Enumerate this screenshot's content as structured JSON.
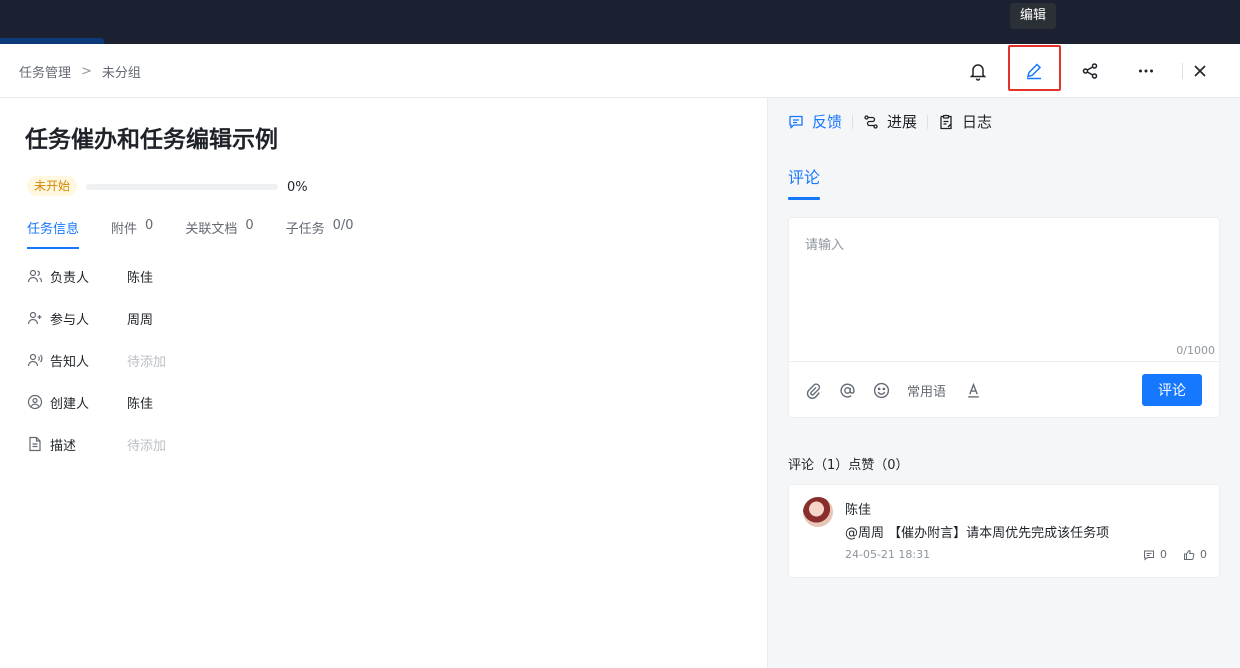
{
  "tooltip": "编辑",
  "breadcrumb": {
    "parent": "任务管理",
    "separator": ">",
    "current": "未分组"
  },
  "header_icons": {
    "notify": "bell-icon",
    "edit": "pencil-icon",
    "share": "share-icon",
    "more": "more-icon",
    "close": "close-icon"
  },
  "task": {
    "title": "任务催办和任务编辑示例",
    "status": "未开始",
    "progress_percent": 0,
    "progress_text": "0%"
  },
  "tabs": [
    {
      "label": "任务信息",
      "count": ""
    },
    {
      "label": "附件",
      "count": "0"
    },
    {
      "label": "关联文档",
      "count": "0"
    },
    {
      "label": "子任务",
      "count": "0/0"
    }
  ],
  "fields": [
    {
      "label": "负责人",
      "value": "陈佳",
      "icon": "owner-icon"
    },
    {
      "label": "参与人",
      "value": "周周",
      "icon": "add-user-icon"
    },
    {
      "label": "告知人",
      "value": "待添加",
      "icon": "notify-user-icon"
    },
    {
      "label": "创建人",
      "value": "陈佳",
      "icon": "user-circle-icon"
    },
    {
      "label": "描述",
      "value": "待添加",
      "icon": "document-icon"
    }
  ],
  "right_tabs": [
    {
      "label": "反馈",
      "icon": "feedback-icon"
    },
    {
      "label": "进展",
      "icon": "progress-icon"
    },
    {
      "label": "日志",
      "icon": "log-icon"
    }
  ],
  "comment_section": {
    "subtab": "评论",
    "placeholder": "请输入",
    "char_count": "0/1000",
    "phrases_label": "常用语",
    "submit_label": "评论",
    "summary": "评论（1）点赞（0）"
  },
  "comments": [
    {
      "author": "陈佳",
      "text": "@周周 【催办附言】请本周优先完成该任务项",
      "time": "24-05-21 18:31",
      "replies": "0",
      "likes": "0"
    }
  ],
  "colors": {
    "accent": "#1677ff",
    "highlight_box": "#e5332a",
    "status": "#d48806",
    "topbar": "#1b2130"
  }
}
